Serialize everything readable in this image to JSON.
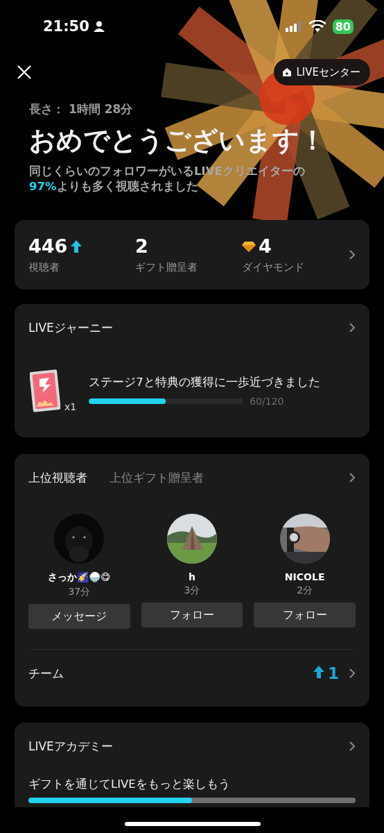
{
  "status_bar": {
    "time": "21:50",
    "battery": "80"
  },
  "header": {
    "center_button": "LIVEセンター"
  },
  "summary": {
    "duration": "長さ： 1時間 28分",
    "title": "おめでとうございます！",
    "description": "同じくらいのフォロワーがいるLIVEクリエイターの\n**97%**よりも多く視聴されました"
  },
  "stats": [
    {
      "kind": "viewers",
      "value": "446",
      "label": "視聴者",
      "trend_up": true
    },
    {
      "kind": "plain",
      "value": "2",
      "label": "ギフト贈呈者",
      "trend_up": false
    },
    {
      "kind": "diamond",
      "value": "4",
      "label": "ダイヤモンド",
      "trend_up": false
    }
  ],
  "journey": {
    "title": "LIVEジャーニー",
    "badge_count": "x1",
    "message": "ステージ7と特典の獲得に一歩近づきました",
    "level": 0.5,
    "progress": "60/120"
  },
  "top": {
    "tabs": [
      {
        "label": "上位視聴者",
        "selected": true
      },
      {
        "label": "上位ギフト贈呈者",
        "selected": false
      }
    ],
    "people": [
      {
        "name": "さっか🌠🍚😋",
        "time": "37分",
        "action": "メッセージ",
        "kind": "picture"
      },
      {
        "name": "h",
        "time": "3分",
        "action": "フォロー",
        "kind": "picture"
      },
      {
        "name": "NICOLE",
        "time": "2分",
        "action": "フォロー",
        "kind": "picture"
      }
    ],
    "team": {
      "label": "チーム",
      "value": "1",
      "trend_up": true
    }
  },
  "academy": {
    "title": "LIVEアカデミー",
    "message": "ギフトを通じてLIVEをもっと楽しもう",
    "level": 0.5
  }
}
